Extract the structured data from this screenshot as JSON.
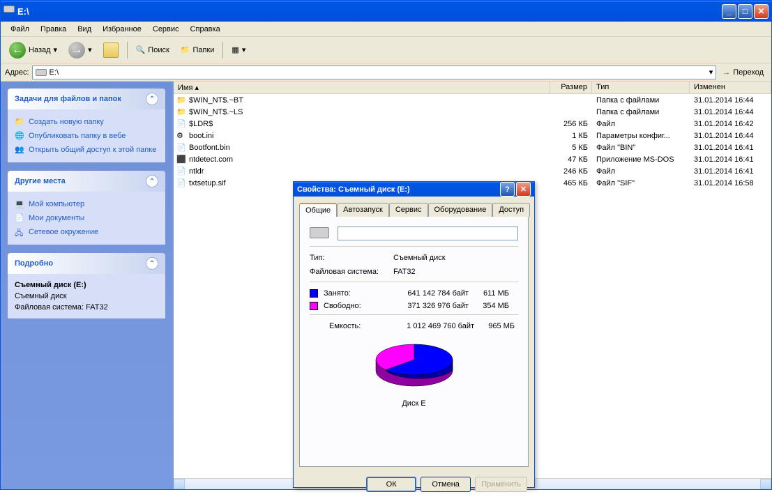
{
  "window": {
    "title": "E:\\"
  },
  "menu": {
    "file": "Файл",
    "edit": "Правка",
    "view": "Вид",
    "favorites": "Избранное",
    "service": "Сервис",
    "help": "Справка"
  },
  "toolbar": {
    "back": "Назад",
    "search": "Поиск",
    "folders": "Папки"
  },
  "addressbar": {
    "label": "Адрес:",
    "value": "E:\\",
    "go": "Переход"
  },
  "sidebar": {
    "tasks": {
      "title": "Задачи для файлов и папок",
      "items": [
        "Создать новую папку",
        "Опубликовать папку в вебе",
        "Открыть общий доступ к этой папке"
      ]
    },
    "places": {
      "title": "Другие места",
      "items": [
        "Мой компьютер",
        "Мои документы",
        "Сетевое окружение"
      ]
    },
    "details": {
      "title": "Подробно",
      "line1": "Съемный диск (E:)",
      "line2": "Съемный диск",
      "line3": "Файловая система: FAT32"
    }
  },
  "columns": {
    "name": "Имя",
    "size": "Размер",
    "type": "Тип",
    "date": "Изменен"
  },
  "files": [
    {
      "name": "$WIN_NT$.~BT",
      "size": "",
      "type": "Папка с файлами",
      "date": "31.01.2014 16:44",
      "icon": "folder"
    },
    {
      "name": "$WIN_NT$.~LS",
      "size": "",
      "type": "Папка с файлами",
      "date": "31.01.2014 16:44",
      "icon": "folder"
    },
    {
      "name": "$LDR$",
      "size": "256 КБ",
      "type": "Файл",
      "date": "31.01.2014 16:42",
      "icon": "file"
    },
    {
      "name": "boot.ini",
      "size": "1 КБ",
      "type": "Параметры конфиг...",
      "date": "31.01.2014 16:44",
      "icon": "ini"
    },
    {
      "name": "Bootfont.bin",
      "size": "5 КБ",
      "type": "Файл \"BIN\"",
      "date": "31.01.2014 16:41",
      "icon": "file"
    },
    {
      "name": "ntdetect.com",
      "size": "47 КБ",
      "type": "Приложение MS-DOS",
      "date": "31.01.2014 16:41",
      "icon": "dos"
    },
    {
      "name": "ntldr",
      "size": "246 КБ",
      "type": "Файл",
      "date": "31.01.2014 16:41",
      "icon": "file"
    },
    {
      "name": "txtsetup.sif",
      "size": "465 КБ",
      "type": "Файл \"SIF\"",
      "date": "31.01.2014 16:58",
      "icon": "file"
    }
  ],
  "dialog": {
    "title": "Свойства: Съемный диск (E:)",
    "tabs": {
      "general": "Общие",
      "autorun": "Автозапуск",
      "service": "Сервис",
      "hardware": "Оборудование",
      "access": "Доступ"
    },
    "type_label": "Тип:",
    "type_value": "Съемный диск",
    "fs_label": "Файловая система:",
    "fs_value": "FAT32",
    "used_label": "Занято:",
    "used_bytes": "641 142 784 байт",
    "used_mb": "611 МБ",
    "free_label": "Свободно:",
    "free_bytes": "371 326 976 байт",
    "free_mb": "354 МБ",
    "cap_label": "Емкость:",
    "cap_bytes": "1 012 469 760 байт",
    "cap_mb": "965 МБ",
    "disk_label": "Диск E",
    "used_color": "#0000ff",
    "free_color": "#ff00ff",
    "ok": "ОК",
    "cancel": "Отмена",
    "apply": "Применить"
  },
  "chart_data": {
    "type": "pie",
    "title": "Диск E",
    "series": [
      {
        "name": "Занято",
        "value": 641142784,
        "display": "611 МБ",
        "color": "#0000ff"
      },
      {
        "name": "Свободно",
        "value": 371326976,
        "display": "354 МБ",
        "color": "#ff00ff"
      }
    ],
    "total": {
      "name": "Емкость",
      "value": 1012469760,
      "display": "965 МБ"
    }
  }
}
